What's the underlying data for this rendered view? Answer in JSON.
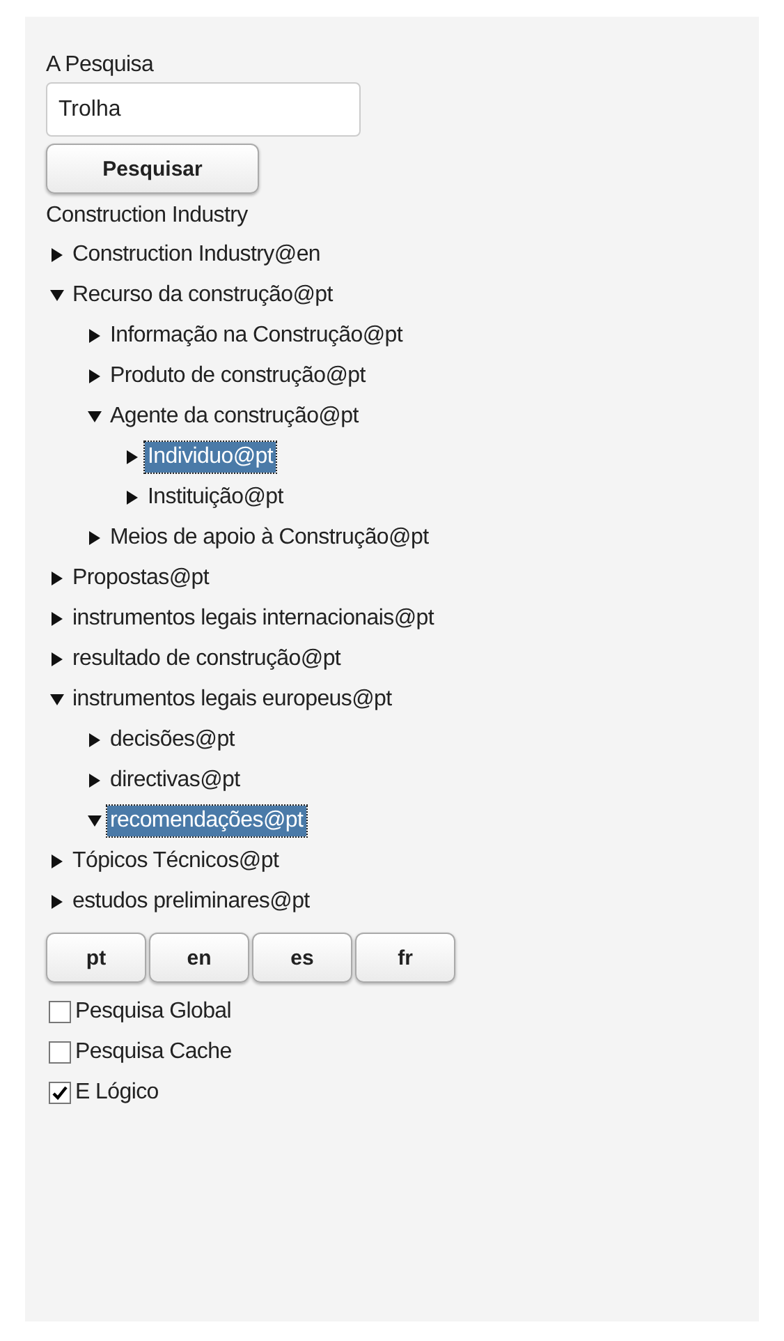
{
  "search": {
    "label": "A Pesquisa",
    "value": "Trolha",
    "button": "Pesquisar"
  },
  "tree": {
    "root": "Construction Industry",
    "items": [
      {
        "label": "Construction Industry@en",
        "expanded": false,
        "selected": false
      },
      {
        "label": "Recurso da construção@pt",
        "expanded": true,
        "selected": false,
        "children": [
          {
            "label": "Informação na Construção@pt",
            "expanded": false,
            "selected": false
          },
          {
            "label": "Produto de construção@pt",
            "expanded": false,
            "selected": false
          },
          {
            "label": "Agente da construção@pt",
            "expanded": true,
            "selected": false,
            "children": [
              {
                "label": "Individuo@pt",
                "expanded": false,
                "selected": true
              },
              {
                "label": "Instituição@pt",
                "expanded": false,
                "selected": false
              }
            ]
          },
          {
            "label": "Meios de apoio à Construção@pt",
            "expanded": false,
            "selected": false
          }
        ]
      },
      {
        "label": "Propostas@pt",
        "expanded": false,
        "selected": false
      },
      {
        "label": "instrumentos legais internacionais@pt",
        "expanded": false,
        "selected": false
      },
      {
        "label": "resultado de construção@pt",
        "expanded": false,
        "selected": false
      },
      {
        "label": "instrumentos legais europeus@pt",
        "expanded": true,
        "selected": false,
        "children": [
          {
            "label": "decisões@pt",
            "expanded": false,
            "selected": false
          },
          {
            "label": "directivas@pt",
            "expanded": false,
            "selected": false
          },
          {
            "label": "recomendações@pt",
            "expanded": true,
            "selected": true
          }
        ]
      },
      {
        "label": "Tópicos Técnicos@pt",
        "expanded": false,
        "selected": false
      },
      {
        "label": "estudos preliminares@pt",
        "expanded": false,
        "selected": false
      }
    ]
  },
  "languages": [
    "pt",
    "en",
    "es",
    "fr"
  ],
  "options": [
    {
      "label": "Pesquisa Global",
      "checked": false
    },
    {
      "label": "Pesquisa Cache",
      "checked": false
    },
    {
      "label": "E Lógico",
      "checked": true
    }
  ]
}
